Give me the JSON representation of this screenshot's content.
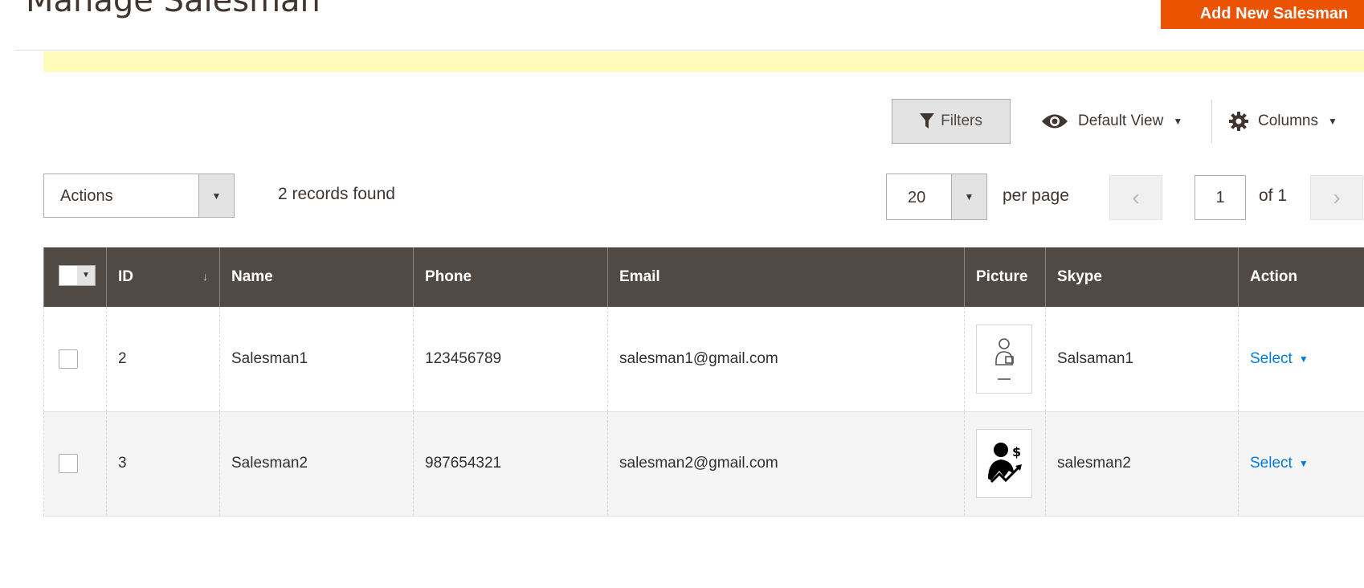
{
  "header": {
    "title": "Manage Salesman",
    "add_button": "Add New Salesman"
  },
  "toolbar": {
    "filters_label": "Filters",
    "view_label": "Default View",
    "columns_label": "Columns"
  },
  "grid_controls": {
    "actions_label": "Actions",
    "records_found": "2 records found",
    "per_page_value": "20",
    "per_page_label": "per page",
    "current_page": "1",
    "of_pages": "of 1"
  },
  "table": {
    "columns": [
      "ID",
      "Name",
      "Phone",
      "Email",
      "Picture",
      "Skype",
      "Action"
    ],
    "rows": [
      {
        "id": "2",
        "name": "Salesman1",
        "phone": "123456789",
        "email": "salesman1@gmail.com",
        "picture": "salesman-outline-icon",
        "skype": "Salsaman1",
        "action": "Select"
      },
      {
        "id": "3",
        "name": "Salesman2",
        "phone": "987654321",
        "email": "salesman2@gmail.com",
        "picture": "salesman-chart-icon",
        "skype": "salesman2",
        "action": "Select"
      }
    ]
  },
  "colors": {
    "accent": "#eb5202",
    "table_header": "#514943",
    "link": "#007bdb",
    "notice": "#fffbbb"
  }
}
